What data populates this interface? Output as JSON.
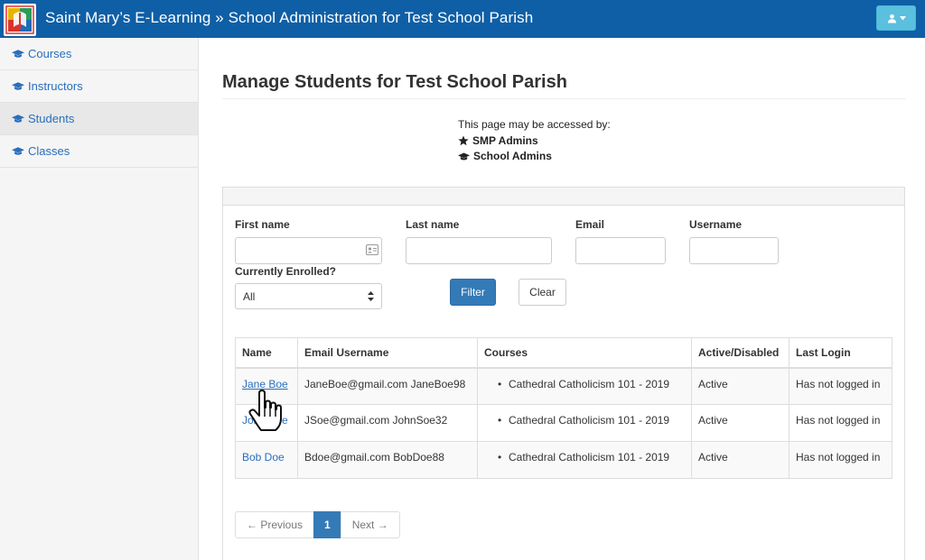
{
  "header": {
    "brand": "Saint Mary’s E-Learning » School Administration for Test School Parish",
    "brand_color": "#0f5fa6",
    "user_button_color": "#5bc0de",
    "logo_icon": "school-logo-icon",
    "user_icon": "user-icon"
  },
  "sidebar": {
    "items": [
      {
        "label": "Courses",
        "icon": "graduation-cap-icon"
      },
      {
        "label": "Instructors",
        "icon": "graduation-cap-icon"
      },
      {
        "label": "Students",
        "icon": "graduation-cap-icon",
        "active": true
      },
      {
        "label": "Classes",
        "icon": "graduation-cap-icon"
      }
    ]
  },
  "main": {
    "title": "Manage Students for Test School Parish",
    "access": {
      "intro": "This page may be accessed by:",
      "roles": [
        {
          "label": "SMP Admins",
          "icon": "star-icon"
        },
        {
          "label": "School Admins",
          "icon": "graduation-cap-icon"
        }
      ]
    }
  },
  "filters": {
    "first_name": {
      "label": "First name",
      "value": "",
      "icon": "contact-card-icon"
    },
    "last_name": {
      "label": "Last name",
      "value": ""
    },
    "email": {
      "label": "Email",
      "value": ""
    },
    "username": {
      "label": "Username",
      "value": ""
    },
    "enrolled": {
      "label": "Currently Enrolled?",
      "selected": "All"
    },
    "filter_button": "Filter",
    "clear_button": "Clear",
    "primary_color": "#337ab7"
  },
  "table": {
    "headers": [
      "Name",
      "Email Username",
      "Courses",
      "Active/Disabled",
      "Last Login"
    ],
    "rows": [
      {
        "name": "Jane Boe",
        "email_username": "JaneBoe@gmail.com JaneBoe98",
        "course": "Cathedral Catholicism 101 - 2019",
        "status": "Active",
        "last_login": "Has not logged in"
      },
      {
        "name": "John Soe",
        "email_username": "JSoe@gmail.com JohnSoe32",
        "course": "Cathedral Catholicism 101 - 2019",
        "status": "Active",
        "last_login": "Has not logged in"
      },
      {
        "name": "Bob Doe",
        "email_username": "Bdoe@gmail.com BobDoe88",
        "course": "Cathedral Catholicism 101 - 2019",
        "status": "Active",
        "last_login": "Has not logged in"
      }
    ]
  },
  "pagination": {
    "previous": "← Previous",
    "current": "1",
    "next": "Next →"
  },
  "cursor": {
    "icon": "hand-pointer-icon"
  }
}
